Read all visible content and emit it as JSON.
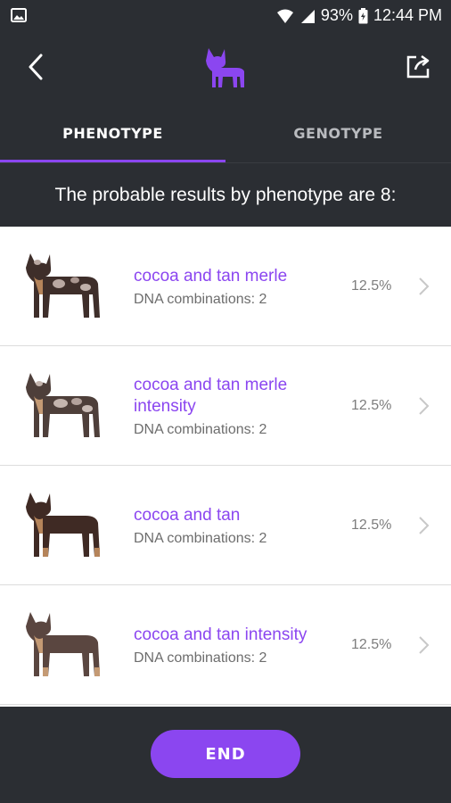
{
  "status_bar": {
    "battery": "93%",
    "time": "12:44 PM",
    "icons": [
      "image-icon",
      "wifi-icon",
      "signal-icon",
      "battery-icon"
    ]
  },
  "header": {
    "icons": [
      "back-arrow-icon",
      "french-bulldog-logo",
      "share-icon"
    ],
    "accent_color": "#8b46f0"
  },
  "tabs": [
    {
      "label": "PHENOTYPE",
      "active": true
    },
    {
      "label": "GENOTYPE",
      "active": false
    }
  ],
  "summary": "The probable results by phenotype are 8:",
  "results": [
    {
      "name": "cocoa and tan merle",
      "dna": "DNA combinations: 2",
      "percent": "12.5%"
    },
    {
      "name": "cocoa and tan merle intensity",
      "dna": "DNA combinations: 2",
      "percent": "12.5%"
    },
    {
      "name": "cocoa and tan",
      "dna": "DNA combinations: 2",
      "percent": "12.5%"
    },
    {
      "name": "cocoa and tan intensity",
      "dna": "DNA combinations: 2",
      "percent": "12.5%"
    }
  ],
  "end_button": "END"
}
